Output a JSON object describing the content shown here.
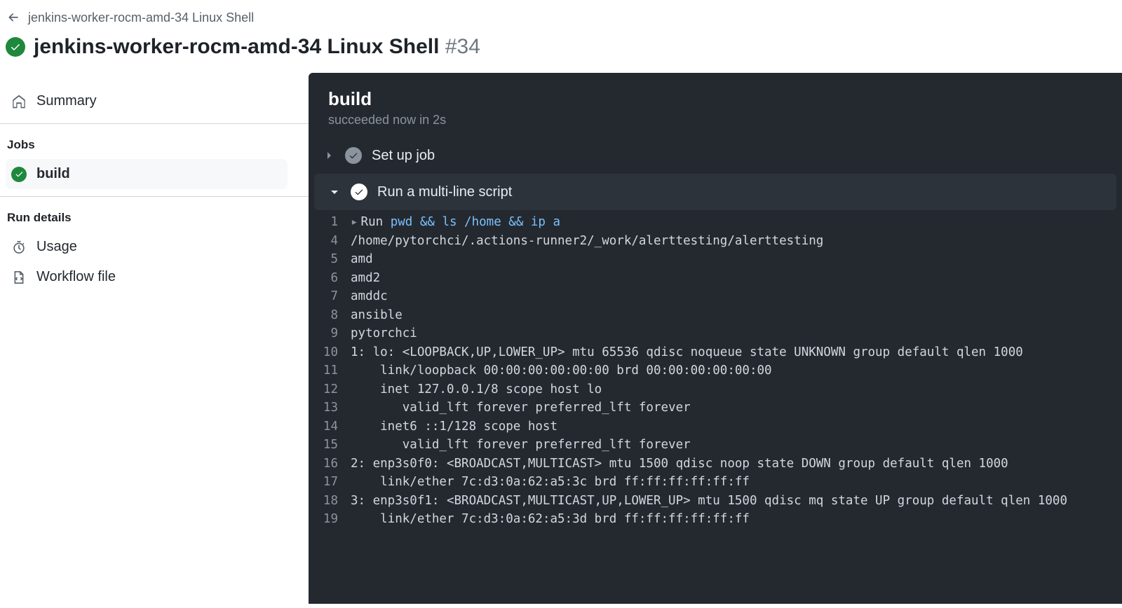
{
  "breadcrumb": "jenkins-worker-rocm-amd-34 Linux Shell",
  "title": {
    "workflow": "jenkins-worker-rocm-amd-34 Linux Shell",
    "run_number": "#34"
  },
  "sidebar": {
    "summary_label": "Summary",
    "jobs_heading": "Jobs",
    "job_label": "build",
    "run_details_heading": "Run details",
    "usage_label": "Usage",
    "workflow_file_label": "Workflow file"
  },
  "log": {
    "job_title": "build",
    "job_status": "succeeded now in 2s",
    "steps": [
      {
        "label": "Set up job",
        "expanded": false
      },
      {
        "label": "Run a multi-line script",
        "expanded": true
      }
    ],
    "run_cmd_prefix": "Run",
    "run_cmd": "pwd && ls /home && ip a",
    "lines": [
      {
        "n": 1,
        "kind": "cmd"
      },
      {
        "n": 4,
        "text": "/home/pytorchci/.actions-runner2/_work/alerttesting/alerttesting"
      },
      {
        "n": 5,
        "text": "amd"
      },
      {
        "n": 6,
        "text": "amd2"
      },
      {
        "n": 7,
        "text": "amddc"
      },
      {
        "n": 8,
        "text": "ansible"
      },
      {
        "n": 9,
        "text": "pytorchci"
      },
      {
        "n": 10,
        "text": "1: lo: <LOOPBACK,UP,LOWER_UP> mtu 65536 qdisc noqueue state UNKNOWN group default qlen 1000"
      },
      {
        "n": 11,
        "text": "    link/loopback 00:00:00:00:00:00 brd 00:00:00:00:00:00"
      },
      {
        "n": 12,
        "text": "    inet 127.0.0.1/8 scope host lo"
      },
      {
        "n": 13,
        "text": "       valid_lft forever preferred_lft forever"
      },
      {
        "n": 14,
        "text": "    inet6 ::1/128 scope host "
      },
      {
        "n": 15,
        "text": "       valid_lft forever preferred_lft forever"
      },
      {
        "n": 16,
        "text": "2: enp3s0f0: <BROADCAST,MULTICAST> mtu 1500 qdisc noop state DOWN group default qlen 1000"
      },
      {
        "n": 17,
        "text": "    link/ether 7c:d3:0a:62:a5:3c brd ff:ff:ff:ff:ff:ff"
      },
      {
        "n": 18,
        "text": "3: enp3s0f1: <BROADCAST,MULTICAST,UP,LOWER_UP> mtu 1500 qdisc mq state UP group default qlen 1000"
      },
      {
        "n": 19,
        "text": "    link/ether 7c:d3:0a:62:a5:3d brd ff:ff:ff:ff:ff:ff"
      }
    ]
  }
}
